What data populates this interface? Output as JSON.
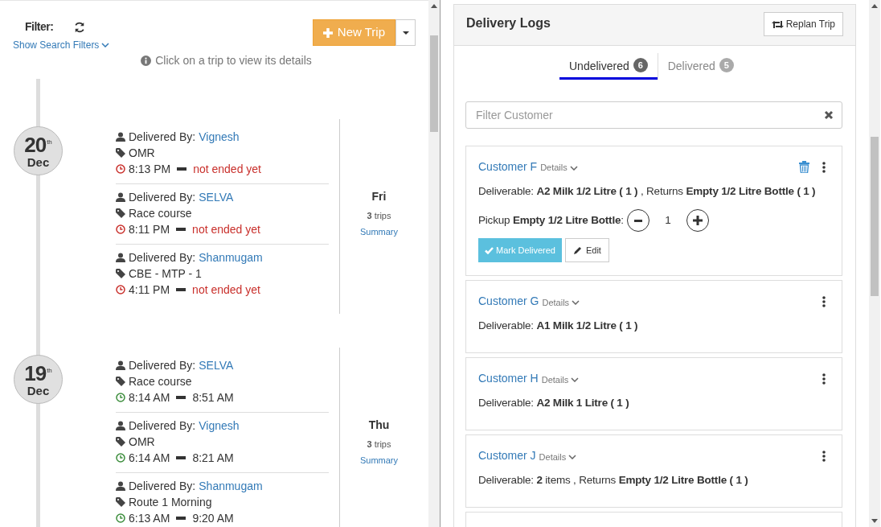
{
  "toolbar": {
    "filter_label": "Filter:",
    "show_filters_link": "Show Search Filters",
    "new_trip_button": "New Trip",
    "hint": "Click on a trip to view its details"
  },
  "days": [
    {
      "day": "20",
      "suffix": "th",
      "month": "Dec",
      "weekday": "Fri",
      "trip_count": "3",
      "trips_label": "trips",
      "summary_link": "Summary",
      "trips": [
        {
          "delivered_by_label": "Delivered By:",
          "driver": "Vignesh",
          "route": "OMR",
          "start": "8:13 PM",
          "end": "not ended yet",
          "ended": false
        },
        {
          "delivered_by_label": "Delivered By:",
          "driver": "SELVA",
          "route": "Race course",
          "start": "8:11 PM",
          "end": "not ended yet",
          "ended": false
        },
        {
          "delivered_by_label": "Delivered By:",
          "driver": "Shanmugam",
          "route": "CBE - MTP - 1",
          "start": "4:11 PM",
          "end": "not ended yet",
          "ended": false
        }
      ]
    },
    {
      "day": "19",
      "suffix": "th",
      "month": "Dec",
      "weekday": "Thu",
      "trip_count": "3",
      "trips_label": "trips",
      "summary_link": "Summary",
      "trips": [
        {
          "delivered_by_label": "Delivered By:",
          "driver": "SELVA",
          "route": "Race course",
          "start": "8:14 AM",
          "end": "8:51 AM",
          "ended": true
        },
        {
          "delivered_by_label": "Delivered By:",
          "driver": "Vignesh",
          "route": "OMR",
          "start": "6:14 AM",
          "end": "8:21 AM",
          "ended": true
        },
        {
          "delivered_by_label": "Delivered By:",
          "driver": "Shanmugam",
          "route": "Route 1 Morning",
          "start": "6:13 AM",
          "end": "9:20 AM",
          "ended": true
        }
      ]
    }
  ],
  "delivery_logs": {
    "title": "Delivery Logs",
    "replan_button": "Replan Trip",
    "tabs": [
      {
        "label": "Undelivered",
        "count": "6",
        "selected": true
      },
      {
        "label": "Delivered",
        "count": "5",
        "selected": false
      }
    ],
    "filter": {
      "placeholder": "Filter Customer"
    },
    "customers": [
      {
        "name": "Customer F",
        "details_label": "Details",
        "deletable": true,
        "deliverable": "Deliverable: **A2 Milk 1/2 Litre ( 1 )** , Returns **Empty 1/2 Litre Bottle ( 1 )**",
        "pickup": {
          "label": "Pickup **Empty 1/2 Litre Bottle**:",
          "value": "1"
        },
        "actions": [
          {
            "kind": "mark",
            "label": "Mark Delivered"
          },
          {
            "kind": "edit",
            "label": "Edit"
          }
        ]
      },
      {
        "name": "Customer G",
        "details_label": "Details",
        "deletable": false,
        "deliverable": "Deliverable: **A1 Milk 1/2 Litre ( 1 )**"
      },
      {
        "name": "Customer H",
        "details_label": "Details",
        "deletable": false,
        "deliverable": "Deliverable: **A2 Milk 1 Litre ( 1 )**"
      },
      {
        "name": "Customer J",
        "details_label": "Details",
        "deletable": false,
        "deliverable": "Deliverable: **2** items , Returns **Empty 1/2 Litre Bottle ( 1 )**"
      }
    ]
  }
}
